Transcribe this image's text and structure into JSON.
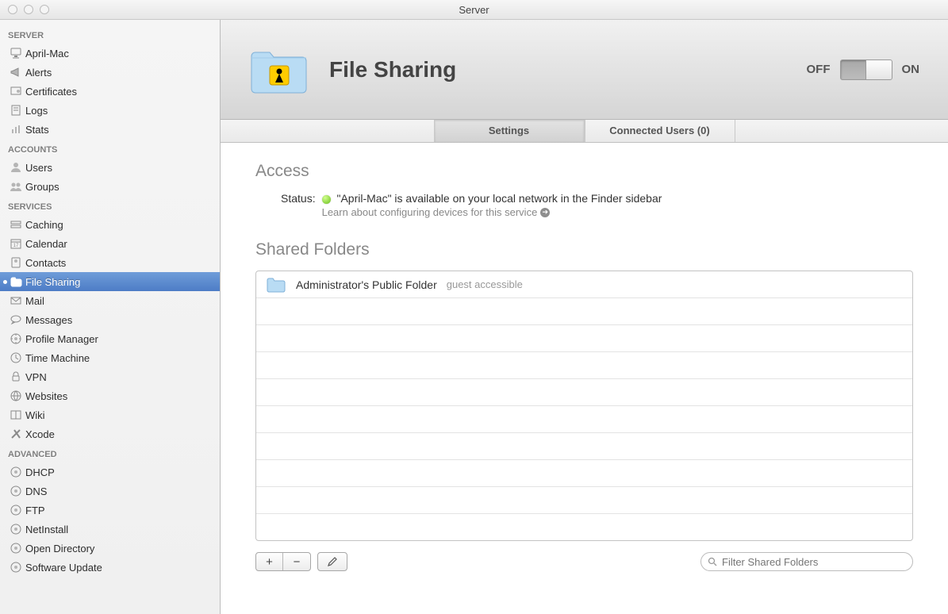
{
  "window": {
    "title": "Server"
  },
  "sidebar": {
    "sections": [
      {
        "title": "SERVER",
        "items": [
          {
            "label": "April-Mac",
            "icon": "imac",
            "selected": false
          },
          {
            "label": "Alerts",
            "icon": "megaphone",
            "selected": false
          },
          {
            "label": "Certificates",
            "icon": "cert",
            "selected": false
          },
          {
            "label": "Logs",
            "icon": "log",
            "selected": false
          },
          {
            "label": "Stats",
            "icon": "stats",
            "selected": false
          }
        ]
      },
      {
        "title": "ACCOUNTS",
        "items": [
          {
            "label": "Users",
            "icon": "user",
            "selected": false
          },
          {
            "label": "Groups",
            "icon": "group",
            "selected": false
          }
        ]
      },
      {
        "title": "SERVICES",
        "items": [
          {
            "label": "Caching",
            "icon": "caching",
            "selected": false
          },
          {
            "label": "Calendar",
            "icon": "calendar",
            "selected": false
          },
          {
            "label": "Contacts",
            "icon": "contacts",
            "selected": false
          },
          {
            "label": "File Sharing",
            "icon": "fileshare",
            "selected": true
          },
          {
            "label": "Mail",
            "icon": "mail",
            "selected": false
          },
          {
            "label": "Messages",
            "icon": "messages",
            "selected": false
          },
          {
            "label": "Profile Manager",
            "icon": "profile",
            "selected": false
          },
          {
            "label": "Time Machine",
            "icon": "tm",
            "selected": false
          },
          {
            "label": "VPN",
            "icon": "vpn",
            "selected": false
          },
          {
            "label": "Websites",
            "icon": "web",
            "selected": false
          },
          {
            "label": "Wiki",
            "icon": "wiki",
            "selected": false
          },
          {
            "label": "Xcode",
            "icon": "xcode",
            "selected": false
          }
        ]
      },
      {
        "title": "ADVANCED",
        "items": [
          {
            "label": "DHCP",
            "icon": "dhcp",
            "selected": false
          },
          {
            "label": "DNS",
            "icon": "dns",
            "selected": false
          },
          {
            "label": "FTP",
            "icon": "ftp",
            "selected": false
          },
          {
            "label": "NetInstall",
            "icon": "neti",
            "selected": false
          },
          {
            "label": "Open Directory",
            "icon": "od",
            "selected": false
          },
          {
            "label": "Software Update",
            "icon": "su",
            "selected": false
          }
        ]
      }
    ]
  },
  "header": {
    "title": "File Sharing",
    "switch_off": "OFF",
    "switch_on": "ON",
    "switch_state": "off"
  },
  "tabs": [
    {
      "label": "Settings",
      "active": true
    },
    {
      "label": "Connected Users (0)",
      "active": false
    }
  ],
  "access": {
    "heading": "Access",
    "status_label": "Status:",
    "status_text": "\"April-Mac\" is available on your local network in the Finder sidebar",
    "learn_text": "Learn about configuring devices for this service"
  },
  "shared": {
    "heading": "Shared Folders",
    "rows": [
      {
        "name": "Administrator's Public Folder",
        "note": "guest accessible"
      }
    ],
    "empty_rows": 9,
    "add_label": "+",
    "remove_label": "−",
    "search_placeholder": "Filter Shared Folders"
  }
}
